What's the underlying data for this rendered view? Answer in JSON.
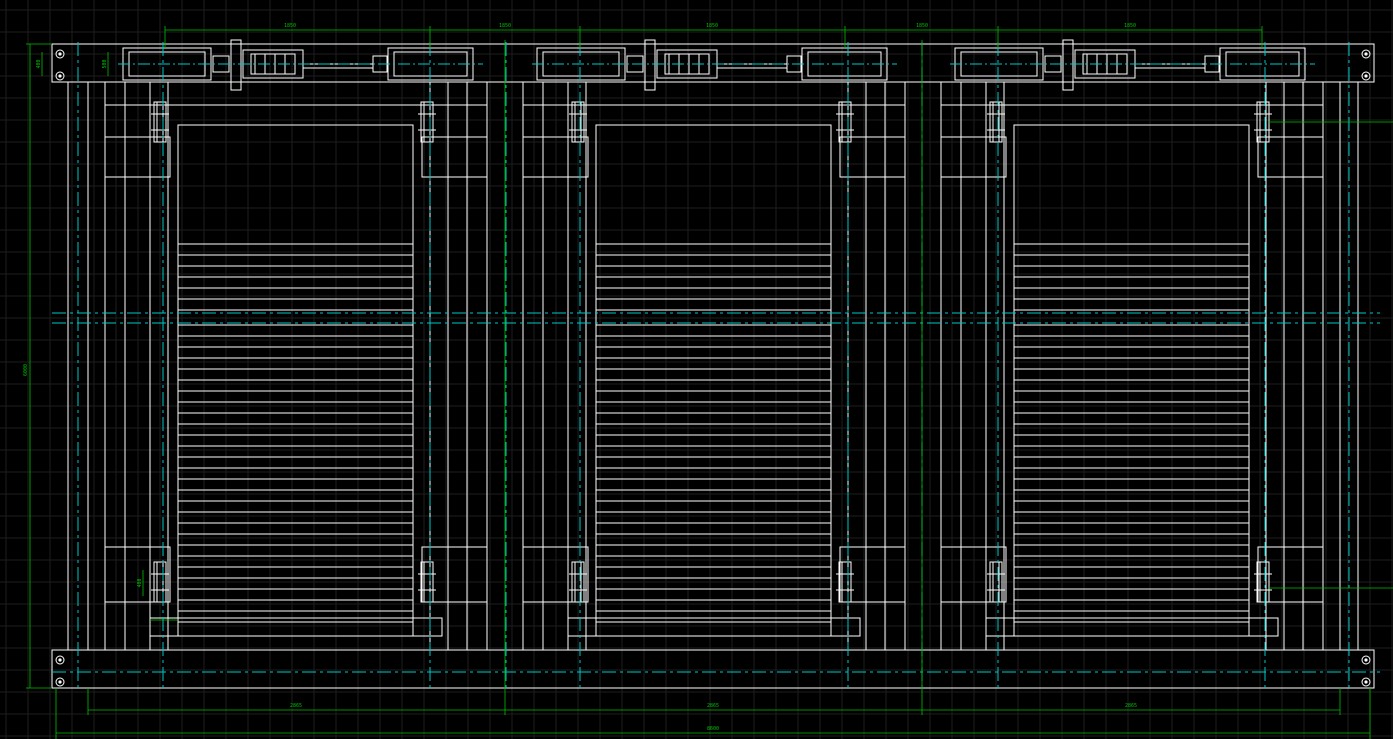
{
  "canvas": {
    "background_color": "#000000",
    "grid_color": "#1c1c1c",
    "grid_major_color": "#262626"
  },
  "colors": {
    "outline": "#ffffff",
    "centerline": "#00c8c8",
    "dimension": "#00c000"
  },
  "drawing": {
    "description_lanes": 3,
    "top_dimensions": [
      "1850",
      "1850",
      "1850",
      "1850",
      "1850"
    ],
    "bottom_dimensions": [
      "2865",
      "2865",
      "2865"
    ],
    "overall_width_dimension": "8600",
    "overall_height_dimension": "6000",
    "small_dimensions": [
      "400",
      "500",
      "400"
    ]
  }
}
